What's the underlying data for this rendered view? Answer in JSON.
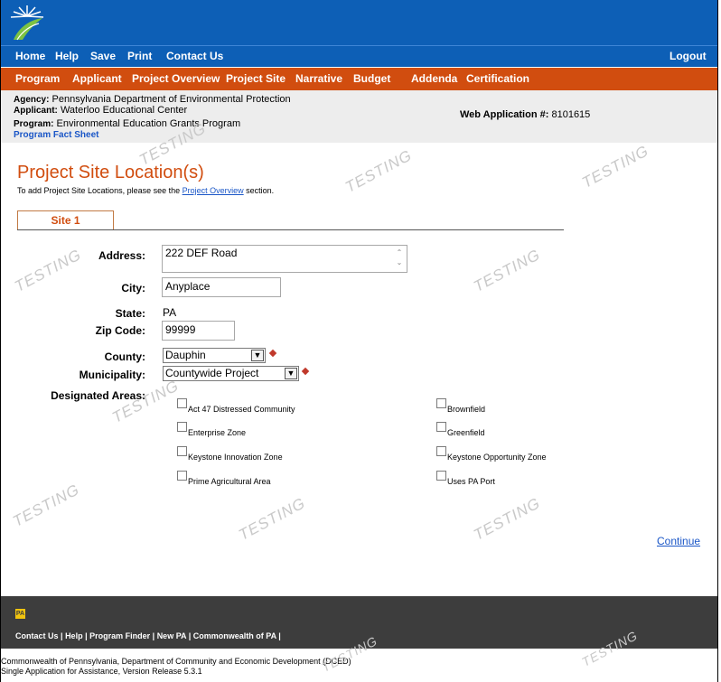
{
  "topnav": {
    "items": [
      "Home",
      "Help",
      "Save",
      "Print",
      "Contact Us"
    ],
    "logout": "Logout"
  },
  "sectionnav": {
    "items": [
      "Program",
      "Applicant",
      "Project Overview",
      "Project Site",
      "Narrative",
      "Budget",
      "Addenda",
      "Certification"
    ]
  },
  "info": {
    "agency_label": "Agency:",
    "agency": "Pennsylvania Department of Environmental Protection",
    "applicant_label": "Applicant:",
    "applicant": "Waterloo Educational Center",
    "program_label": "Program:",
    "program": "Environmental Education Grants Program",
    "fact_sheet": "Program Fact Sheet",
    "webapp_label": "Web Application #:",
    "webapp_number": "8101615"
  },
  "page": {
    "title": "Project Site Location(s)",
    "hint_pre": "To add Project Site Locations, please see the ",
    "hint_link": "Project Overview",
    "hint_post": " section.",
    "tab": "Site 1"
  },
  "form": {
    "address_label": "Address:",
    "address": "222 DEF Road",
    "city_label": "City:",
    "city": "Anyplace",
    "state_label": "State:",
    "state": "PA",
    "zip_label": "Zip Code:",
    "zip": "99999",
    "county_label": "County:",
    "county": "Dauphin",
    "municipality_label": "Municipality:",
    "municipality": "Countywide Project",
    "designated_label": "Designated Areas:",
    "areas": {
      "act47": "Act 47 Distressed Community",
      "brownfield": "Brownfield",
      "enterprise": "Enterprise Zone",
      "greenfield": "Greenfield",
      "keystone_innovation": "Keystone Innovation Zone",
      "keystone_opportunity": "Keystone Opportunity Zone",
      "prime_ag": "Prime Agricultural Area",
      "pa_port": "Uses PA Port"
    }
  },
  "continue": "Continue",
  "footer": {
    "badge": "PA",
    "links": [
      "Contact Us",
      "Help",
      "Program Finder",
      "New PA",
      "Commonwealth of PA"
    ],
    "copyright": "Commonwealth of Pennsylvania, Department of Community and Economic Development (DCED)",
    "version": "Single Application for Assistance, Version Release 5.3.1"
  },
  "watermark": "TESTING",
  "colors": {
    "brand_blue": "#0d5fb6",
    "brand_orange": "#d14d0f",
    "link": "#1a56c7",
    "footer": "#3d3d3d"
  }
}
